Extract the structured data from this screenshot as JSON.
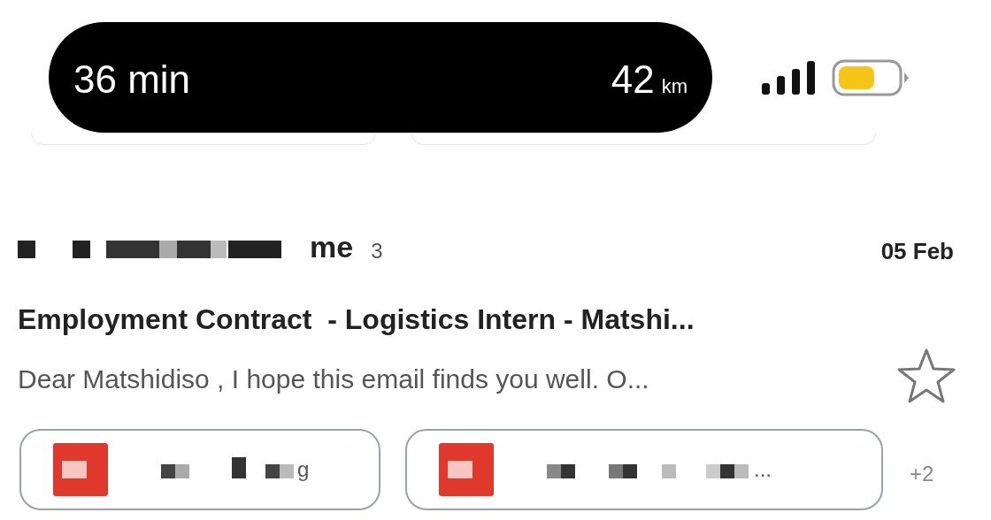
{
  "trip_bar": {
    "duration": "36 min",
    "distance": "42",
    "unit": "km"
  },
  "email": {
    "sender_visible": "me",
    "count": "3",
    "date": "05 Feb",
    "subject": "Employment Contract  - Logistics Intern - Matshi...",
    "preview": "Dear Matshidiso , I hope this email finds you well. O...",
    "starred": false,
    "attachments": [
      {
        "name_visible": "g"
      },
      {
        "name_visible": "..."
      }
    ],
    "more_attachments": "+2"
  }
}
